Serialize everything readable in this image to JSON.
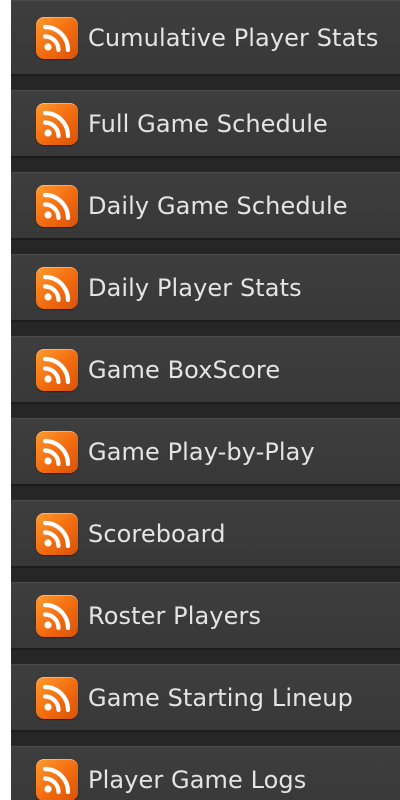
{
  "feeds": {
    "items": [
      {
        "label": "Cumulative Player Stats",
        "icon": "rss-icon"
      },
      {
        "label": "Full Game Schedule",
        "icon": "rss-icon"
      },
      {
        "label": "Daily Game Schedule",
        "icon": "rss-icon"
      },
      {
        "label": "Daily Player Stats",
        "icon": "rss-icon"
      },
      {
        "label": "Game BoxScore",
        "icon": "rss-icon"
      },
      {
        "label": "Game Play-by-Play",
        "icon": "rss-icon"
      },
      {
        "label": "Scoreboard",
        "icon": "rss-icon"
      },
      {
        "label": "Roster Players",
        "icon": "rss-icon"
      },
      {
        "label": "Game Starting Lineup",
        "icon": "rss-icon"
      },
      {
        "label": "Player Game Logs",
        "icon": "rss-icon"
      }
    ]
  },
  "colors": {
    "icon_orange": "#f26b0f",
    "item_background": "#3b3b3b",
    "label_text": "#e4e4e4"
  }
}
